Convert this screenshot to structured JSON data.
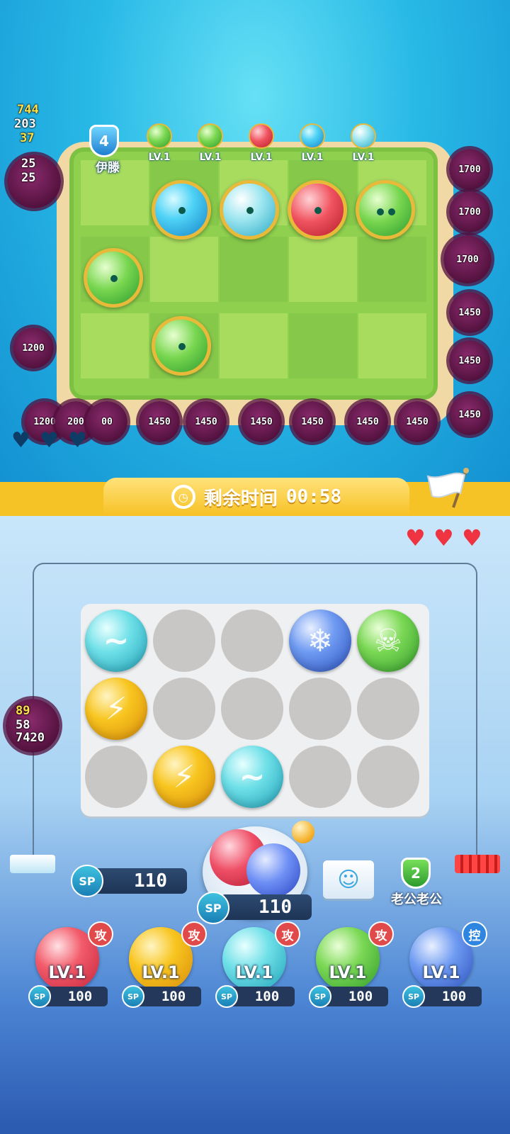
{
  "opponent": {
    "rank": "4",
    "name": "伊滕",
    "skills": [
      {
        "lv": "LV.1",
        "color": "#5cd24a"
      },
      {
        "lv": "LV.1",
        "color": "#4fd6a8"
      },
      {
        "lv": "LV.1",
        "color": "#ef5363"
      },
      {
        "lv": "LV.1",
        "color": "#4fd6f5"
      },
      {
        "lv": "LV.1",
        "color": "#7ed8e8"
      }
    ],
    "damage_numbers": [
      "744",
      "203",
      "37",
      "25",
      "25"
    ],
    "enemies_right": [
      "1700",
      "1700",
      "1700",
      "1450",
      "1450",
      "1450"
    ],
    "enemies_left": [
      "1200"
    ],
    "enemies_bottom": [
      "1200",
      "200",
      "00",
      "1450",
      "1450",
      "1450",
      "1450",
      "1450",
      "1450"
    ]
  },
  "timer": {
    "label": "剩余时间",
    "value": "00:58"
  },
  "player": {
    "lives": 3,
    "side_damage": [
      "89",
      "58",
      "7420"
    ],
    "sp_label": "SP",
    "sp_value": "110",
    "summon_cost": "110",
    "rank": "2",
    "name": "老公老公",
    "board": [
      [
        "wind",
        "empty",
        "empty",
        "ice",
        "poison"
      ],
      [
        "bolt",
        "empty",
        "empty",
        "empty",
        "empty"
      ],
      [
        "empty",
        "bolt",
        "wind",
        "empty",
        "empty"
      ]
    ],
    "deck": [
      {
        "type": "fire",
        "tag": "攻",
        "lv": "LV.1",
        "cost": "100"
      },
      {
        "type": "bolt",
        "tag": "攻",
        "lv": "LV.1",
        "cost": "100"
      },
      {
        "type": "wind",
        "tag": "攻",
        "lv": "LV.1",
        "cost": "100"
      },
      {
        "type": "poison",
        "tag": "攻",
        "lv": "LV.1",
        "cost": "100"
      },
      {
        "type": "ice",
        "tag": "控",
        "lv": "LV.1",
        "cost": "100"
      }
    ]
  },
  "icons": {
    "alarm": "alarm-clock-icon",
    "flag": "surrender-flag-icon",
    "emoji": "emoji-icon",
    "heart": "heart-icon"
  },
  "colors": {
    "timer_bar": "#f6c326",
    "heart": "#ef3340",
    "grass": "#8fd14f",
    "enemy": "#54123f"
  }
}
